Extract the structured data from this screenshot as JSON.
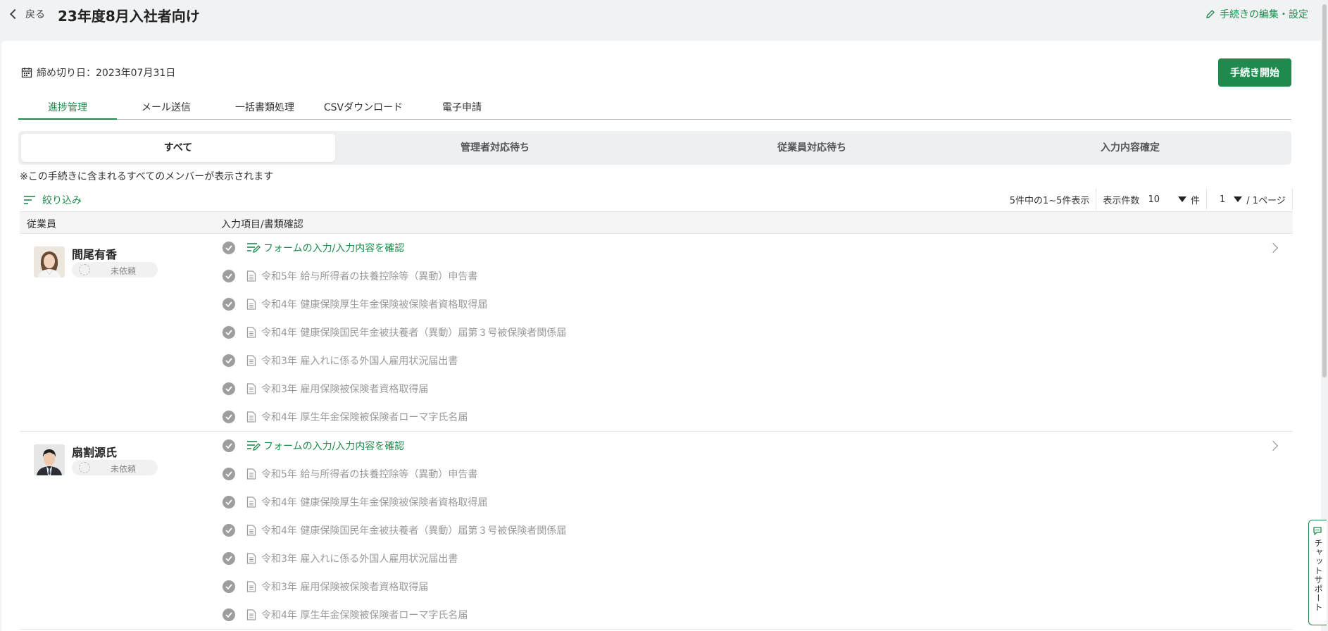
{
  "header": {
    "back_label": "戻る",
    "title": "23年度8月入社者向け",
    "edit_label": "手続きの編集・設定"
  },
  "deadline": {
    "label": "締め切り日：2023年07月31日"
  },
  "start_button": "手続き開始",
  "tabs": [
    {
      "label": "進捗管理"
    },
    {
      "label": "メール送信"
    },
    {
      "label": "一括書類処理"
    },
    {
      "label": "CSVダウンロード"
    },
    {
      "label": "電子申請"
    }
  ],
  "segments": [
    {
      "label": "すべて"
    },
    {
      "label": "管理者対応待ち"
    },
    {
      "label": "従業員対応待ち"
    },
    {
      "label": "入力内容確定"
    }
  ],
  "note": "※この手続きに含まれるすべてのメンバーが表示されます",
  "filter_label": "絞り込み",
  "pagination": {
    "summary": "5件中の1~5件表示",
    "per_page_label": "表示件数",
    "per_page_value": "10",
    "per_page_unit": "件",
    "page_value": "1",
    "page_suffix": "/ 1ページ"
  },
  "table": {
    "col_employee": "従業員",
    "col_items": "入力項目/書類確認"
  },
  "employees": [
    {
      "name": "間尾有香",
      "status": "未依頼",
      "form_link": "フォームの入力/入力内容を確認",
      "documents": [
        "令和5年 給与所得者の扶養控除等（異動）申告書",
        "令和4年 健康保険厚生年金保険被保険者資格取得届",
        "令和4年 健康保険国民年金被扶養者（異動）届第３号被保険者関係届",
        "令和3年 雇入れに係る外国人雇用状況届出書",
        "令和3年 雇用保険被保険者資格取得届",
        "令和4年 厚生年金保険被保険者ローマ字氏名届"
      ]
    },
    {
      "name": "扇割源氏",
      "status": "未依頼",
      "form_link": "フォームの入力/入力内容を確認",
      "documents": [
        "令和5年 給与所得者の扶養控除等（異動）申告書",
        "令和4年 健康保険厚生年金保険被保険者資格取得届",
        "令和4年 健康保険国民年金被扶養者（異動）届第３号被保険者関係届",
        "令和3年 雇入れに係る外国人雇用状況届出書",
        "令和3年 雇用保険被保険者資格取得届",
        "令和4年 厚生年金保険被保険者ローマ字氏名届"
      ]
    }
  ],
  "chat_support": "チャットサポート",
  "colors": {
    "accent": "#1e8a4c",
    "muted": "#9a9a9a",
    "background": "#f1f2f4"
  }
}
